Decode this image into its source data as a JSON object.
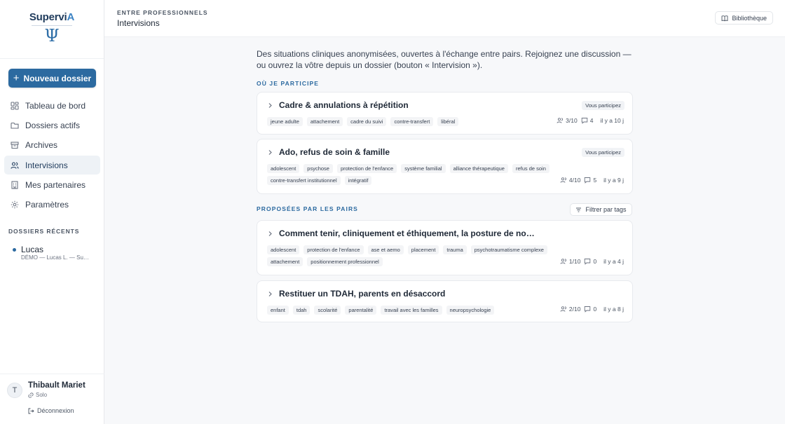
{
  "app": {
    "logo_main": "Supervi",
    "logo_accent": "A",
    "logo_symbol": "Ψ"
  },
  "sidebar": {
    "new_button": "Nouveau dossier",
    "nav": [
      {
        "label": "Tableau de bord",
        "icon": "dashboard-icon"
      },
      {
        "label": "Dossiers actifs",
        "icon": "folder-icon"
      },
      {
        "label": "Archives",
        "icon": "archive-icon"
      },
      {
        "label": "Intervisions",
        "icon": "users-icon",
        "active": true
      },
      {
        "label": "Mes partenaires",
        "icon": "building-icon"
      },
      {
        "label": "Paramètres",
        "icon": "gear-icon"
      }
    ],
    "recent_title": "Dossiers récents",
    "recent": [
      {
        "name": "Lucas",
        "sub": "DÉMO — Lucas L. — Su…"
      }
    ],
    "user": {
      "initial": "T",
      "name": "Thibault Mariet",
      "plan": "Solo",
      "logout": "Déconnexion"
    }
  },
  "header": {
    "eyebrow": "Entre professionnels",
    "title": "Intervisions",
    "library": "Bibliothèque"
  },
  "main": {
    "intro": "Des situations cliniques anonymisées, ouvertes à l'échange entre pairs. Rejoignez une discussion — ou ouvrez la vôtre depuis un dossier (bouton « Intervision »).",
    "section_participating": "Où je participe",
    "section_proposed": "Proposées par les pairs",
    "filter": "Filtrer par tags",
    "participating": [
      {
        "title": "Cadre & annulations à répétition",
        "badge": "Vous participez",
        "tags": [
          "jeune adulte",
          "attachement",
          "cadre du suivi",
          "contre-transfert",
          "libéral"
        ],
        "members": "3/10",
        "comments": "4",
        "age": "il y a 10 j"
      },
      {
        "title": "Ado, refus de soin & famille",
        "badge": "Vous participez",
        "tags": [
          "adolescent",
          "psychose",
          "protection de l'enfance",
          "système familial",
          "alliance thérapeutique",
          "refus de soin",
          "contre-transfert institutionnel",
          "intégratif"
        ],
        "members": "4/10",
        "comments": "5",
        "age": "il y a 9 j"
      }
    ],
    "proposed": [
      {
        "title": "Comment tenir, cliniquement et éthiquement, la posture de no…",
        "tags": [
          "adolescent",
          "protection de l'enfance",
          "ase et aemo",
          "placement",
          "trauma",
          "psychotraumatisme complexe",
          "attachement",
          "positionnement professionnel"
        ],
        "members": "1/10",
        "comments": "0",
        "age": "il y a 4 j"
      },
      {
        "title": "Restituer un TDAH, parents en désaccord",
        "tags": [
          "enfant",
          "tdah",
          "scolarité",
          "parentalité",
          "travail avec les familles",
          "neuropsychologie"
        ],
        "members": "2/10",
        "comments": "0",
        "age": "il y a 8 j"
      }
    ]
  }
}
